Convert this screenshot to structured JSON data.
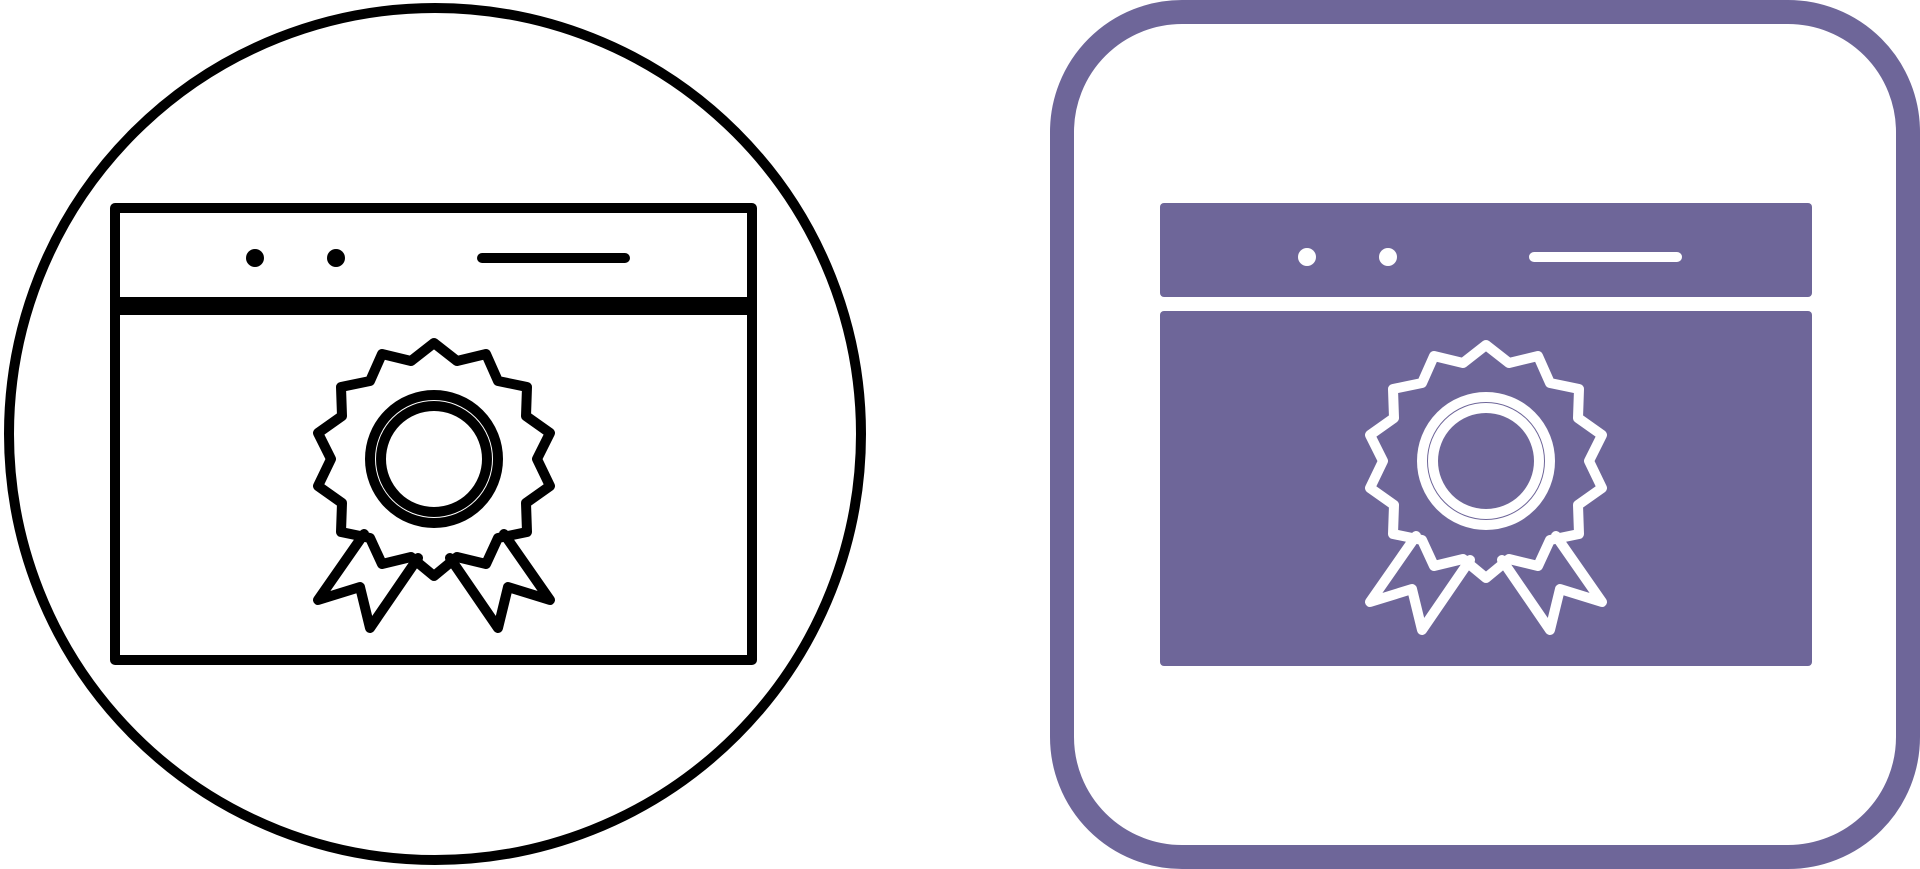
{
  "icons": [
    {
      "name": "web-certificate-line-icon",
      "style": "outline",
      "container": "circle",
      "stroke_color": "#000000",
      "fill_color": "#ffffff"
    },
    {
      "name": "web-certificate-filled-icon",
      "style": "glyph",
      "container": "rounded-square",
      "accent_color": "#6e6699",
      "glyph_color": "#ffffff"
    }
  ]
}
